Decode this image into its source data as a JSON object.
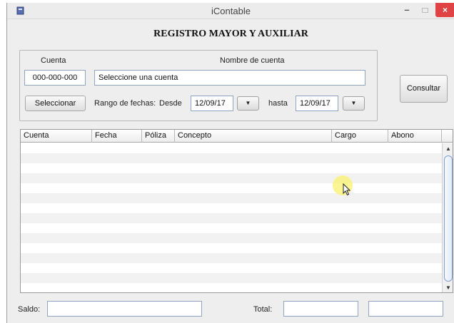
{
  "window": {
    "title": "iContable",
    "minimize_glyph": "–",
    "close_glyph": "×",
    "icon": "app-icon"
  },
  "heading": "REGISTRO MAYOR Y AUXILIAR",
  "account": {
    "code_label": "Cuenta",
    "name_label": "Nombre de cuenta",
    "code_value": "000-000-000",
    "name_value": "Seleccione una cuenta",
    "select_button": "Seleccionar"
  },
  "date_range": {
    "label": "Rango de fechas:",
    "from_label": "Desde",
    "from_value": "12/09/17",
    "to_label": "hasta",
    "to_value": "12/09/17",
    "dropdown_glyph": "▼"
  },
  "consult_button": "Consultar",
  "table": {
    "columns": [
      "Cuenta",
      "Fecha",
      "Póliza",
      "Concepto",
      "Cargo",
      "Abono"
    ],
    "rows": []
  },
  "footer": {
    "saldo_label": "Saldo:",
    "saldo_value": "",
    "total_label": "Total:",
    "total_cargo_value": "",
    "total_abono_value": ""
  },
  "colors": {
    "field_border": "#8ea6c4",
    "close_button": "#e04343",
    "cursor_highlight": "#faf06e"
  }
}
